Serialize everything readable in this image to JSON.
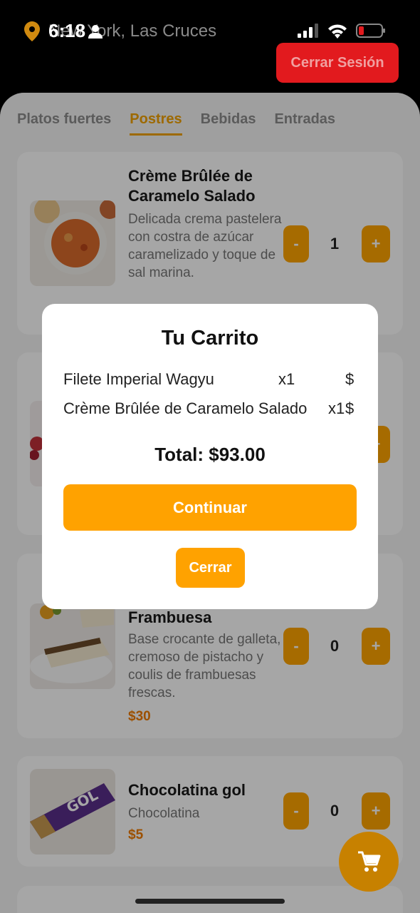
{
  "status": {
    "time": "6:18",
    "location": "New York, Las Cruces"
  },
  "header": {
    "logout_label": "Cerrar Sesión"
  },
  "tabs": [
    {
      "label": "Platos fuertes"
    },
    {
      "label": "Postres"
    },
    {
      "label": "Bebidas"
    },
    {
      "label": "Entradas"
    }
  ],
  "active_tab": "Postres",
  "products": [
    {
      "title": "Crème Brûlée de Caramelo Salado",
      "description": "Delicada crema pastelera con costra de azúcar caramelizado y toque de sal marina.",
      "minus": "-",
      "plus": "+",
      "qty": "1"
    },
    {
      "title": "Frambuesa",
      "description": "Base crocante de galleta, cremoso de pistacho y coulis de frambuesas frescas.",
      "price": "$30",
      "minus": "-",
      "plus": "+",
      "qty": "0"
    },
    {
      "title": "Chocolatina gol",
      "description": "Chocolatina",
      "price": "$5",
      "minus": "-",
      "plus": "+",
      "qty": "0"
    }
  ],
  "modal": {
    "title": "Tu Carrito",
    "items": [
      {
        "name": "Filete Imperial Wagyu",
        "qty": "x1",
        "price": "$"
      },
      {
        "name": "Crème Brûlée de Caramelo Salado",
        "qty": "x1",
        "price": "$"
      }
    ],
    "total": "Total: $93.00",
    "continue_label": "Continuar",
    "close_label": "Cerrar"
  },
  "colors": {
    "accent": "#ffa500",
    "price": "#f07c00",
    "logout": "#e21a1e"
  }
}
